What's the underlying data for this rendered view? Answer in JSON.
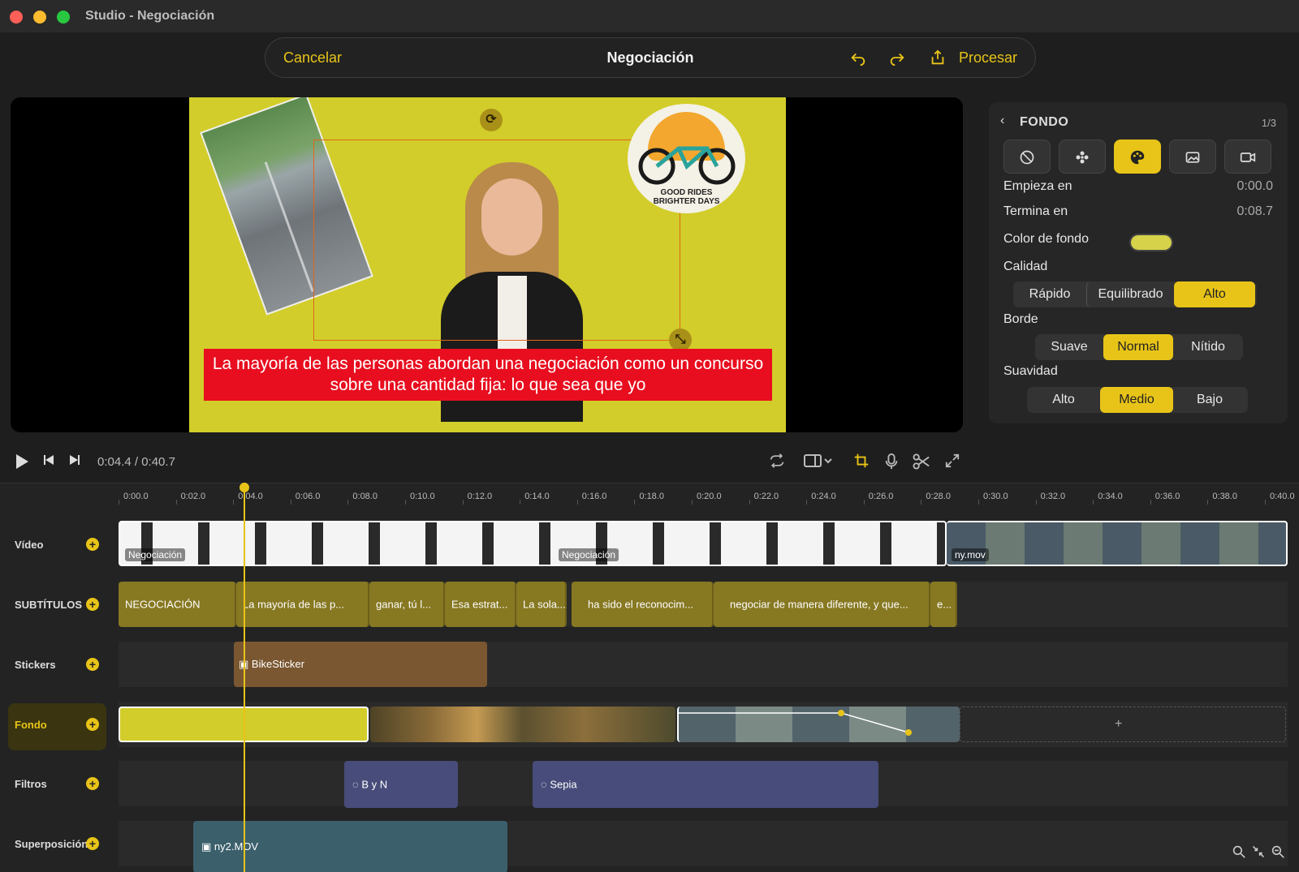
{
  "window": {
    "title": "Studio - Negociación"
  },
  "toolbar": {
    "cancel": "Cancelar",
    "title": "Negociación",
    "undo_icon": "undo-icon",
    "redo_icon": "redo-icon",
    "export_icon": "export-icon",
    "process": "Procesar",
    "accent": "#e8c418"
  },
  "preview": {
    "caption_line1": "La mayoría de las personas abordan una negociación como un concurso",
    "caption_line2": "sobre una cantidad fija: lo que sea que yo",
    "sticker_text1": "GOOD RIDES",
    "sticker_text2": "BRIGHTER DAYS",
    "background_color": "#d2cd2a",
    "caption_color": "#e80e1f"
  },
  "panel": {
    "title": "FONDO",
    "page": "1/3",
    "tabs": [
      {
        "icon": "no-background-icon"
      },
      {
        "icon": "blur-icon"
      },
      {
        "icon": "palette-icon",
        "active": true
      },
      {
        "icon": "image-icon"
      },
      {
        "icon": "video-icon"
      }
    ],
    "starts_label": "Empieza en",
    "starts_value": "0:00.0",
    "ends_label": "Termina en",
    "ends_value": "0:08.7",
    "bg_color_label": "Color de fondo",
    "quality_label": "Calidad",
    "quality_options": [
      "Rápido",
      "Equilibrado",
      "Alto"
    ],
    "quality_selected": "Alto",
    "edge_label": "Borde",
    "edge_options": [
      "Suave",
      "Normal",
      "Nítido"
    ],
    "edge_selected": "Normal",
    "smooth_label": "Suavidad",
    "smooth_options": [
      "Alto",
      "Medio",
      "Bajo"
    ],
    "smooth_selected": "Medio"
  },
  "transport": {
    "time": "0:04.4 / 0:40.7"
  },
  "timeline": {
    "ticks": [
      "0:00.0",
      "0:02.0",
      "0:04.0",
      "0:06.0",
      "0:08.0",
      "0:10.0",
      "0:12.0",
      "0:14.0",
      "0:16.0",
      "0:18.0",
      "0:20.0",
      "0:22.0",
      "0:24.0",
      "0:26.0",
      "0:28.0",
      "0:30.0",
      "0:32.0",
      "0:34.0",
      "0:36.0",
      "0:38.0",
      "0:40.0"
    ],
    "tracks": {
      "video": "Vídeo",
      "subtitles": "SUBTÍTULOS",
      "stickers": "Stickers",
      "fondo": "Fondo",
      "filtros": "Filtros",
      "overlay": "Superposición"
    },
    "video_tags": [
      "Negociación",
      "Negociación",
      "ny.mov"
    ],
    "subtitle_clips": [
      "NEGOCIACIÓN",
      "La mayoría de las p...",
      "ganar, tú l...",
      "Esa estrat...",
      "La sola...",
      "ha sido el reconocim...",
      "negociar de manera diferente, y que...",
      "e..."
    ],
    "sticker_clip": "BikeSticker",
    "fondo_add": "+",
    "filter_clips": [
      "B y N",
      "Sepia"
    ],
    "overlay_clip": "ny2.MOV"
  }
}
